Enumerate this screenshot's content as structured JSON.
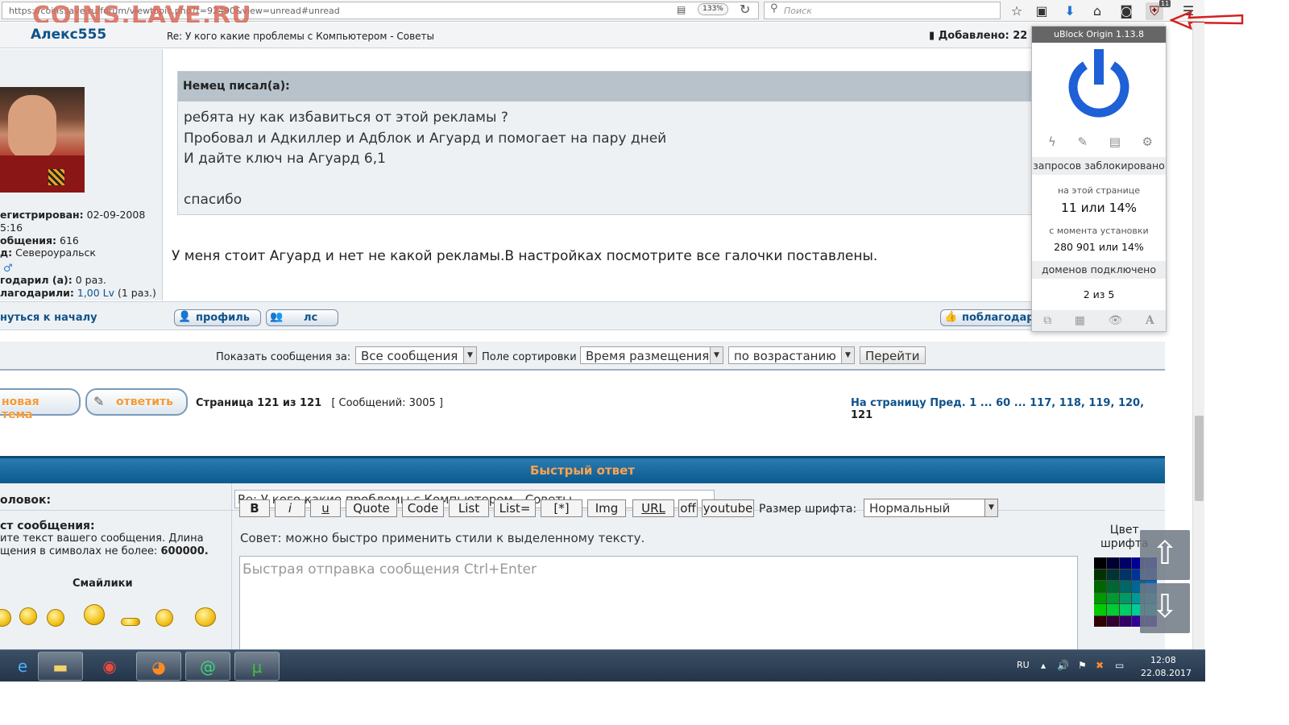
{
  "browser": {
    "url": "https://coins.lave.ru/forum/viewtopic.php?t=92490&view=unread#unread",
    "zoom": "133%",
    "search_placeholder": "Поиск",
    "ublock_badge": "11",
    "watermark": "COINS.LAVE.RU"
  },
  "post": {
    "author": "Алекс555",
    "subject": "Re: У кого какие проблемы с Компьютером - Советы",
    "added_label": "Добавлено: 22",
    "registered_label": "егистрирован:",
    "registered_value": "02-09-2008",
    "registered_time": "5:16",
    "messages_label": "общения:",
    "messages_value": "616",
    "city_label": "д:",
    "city_value": "Североуральск",
    "thanked_label": "годарил (а):",
    "thanked_value": "0 раз.",
    "thanked_by_label": "лагодарили:",
    "thanked_by_link": "1,00 Lv",
    "thanked_by_count": "(1 раз.)",
    "quote_author": "Немец писал(а):",
    "quote_lines": [
      "ребята ну как избавиться от этой рекламы ?",
      "Пробовал и Адкиллер и Адблок и Агуард и помогает на пару дней",
      "И дайте ключ на Агуард 6,1",
      "спасибо"
    ],
    "body": "У меня стоит Агуард и нет не какой рекламы.В настройках посмотрите все галочки поставлены.",
    "back_to_top": "нуться к началу",
    "profile_btn": "профиль",
    "pm_btn": "лс",
    "thanks_btn": "поблагодар"
  },
  "filter": {
    "show_label": "Показать сообщения за:",
    "show_value": "Все сообщения",
    "sort_label": "Поле сортировки",
    "sort_value": "Время размещения",
    "order_value": "по возрастанию",
    "go": "Перейти"
  },
  "pagination": {
    "new_topic": "новая тема",
    "reply": "ответить",
    "page_info": "Страница 121 из 121",
    "messages_info": "[ Сообщений: 3005 ]",
    "prefix": "На страницу Пред.",
    "pages": [
      "1",
      "...",
      "60",
      "...",
      "117,",
      "118,",
      "119,",
      "120,",
      "121"
    ]
  },
  "quick_reply": {
    "title": "Быстрый ответ",
    "subject_label": "оловок:",
    "subject_value": "Re: У кого какие проблемы с Компьютером - Советы",
    "message_label": "ст сообщения:",
    "message_hint_1": "ите текст вашего сообщения. Длина",
    "message_hint_2": "щения в символах не более:",
    "message_hint_max": "600000.",
    "smilies_title": "Смайлики",
    "bbcodes": [
      "B",
      "i",
      "u",
      "Quote",
      "Code",
      "List",
      "List=",
      "[*]",
      "Img",
      "URL",
      "off",
      "youtube"
    ],
    "font_size_label": "Размер шрифта:",
    "font_size_value": "Нормальный",
    "tip": "Совет: можно быстро применить стили к выделенному тексту.",
    "textarea_placeholder": "Быстрая отправка сообщения Ctrl+Enter",
    "color_label_1": "Цвет",
    "color_label_2": "шрифта"
  },
  "ublock": {
    "title": "uBlock Origin 1.13.8",
    "requests_blocked": "запросов заблокировано",
    "on_page_label": "на этой странице",
    "on_page_value": "11 или 14%",
    "since_install_label": "с момента установки",
    "since_install_value": "280 901 или 14%",
    "domains_label": "доменов подключено",
    "domains_value": "2 из 5"
  },
  "taskbar": {
    "lang": "RU",
    "time": "12:08",
    "date": "22.08.2017"
  },
  "colors": {
    "link": "#105289",
    "quick_reply_header": "#0b5a90",
    "quick_reply_title": "#ffa34f",
    "ublock_power": "#1e60d6"
  }
}
